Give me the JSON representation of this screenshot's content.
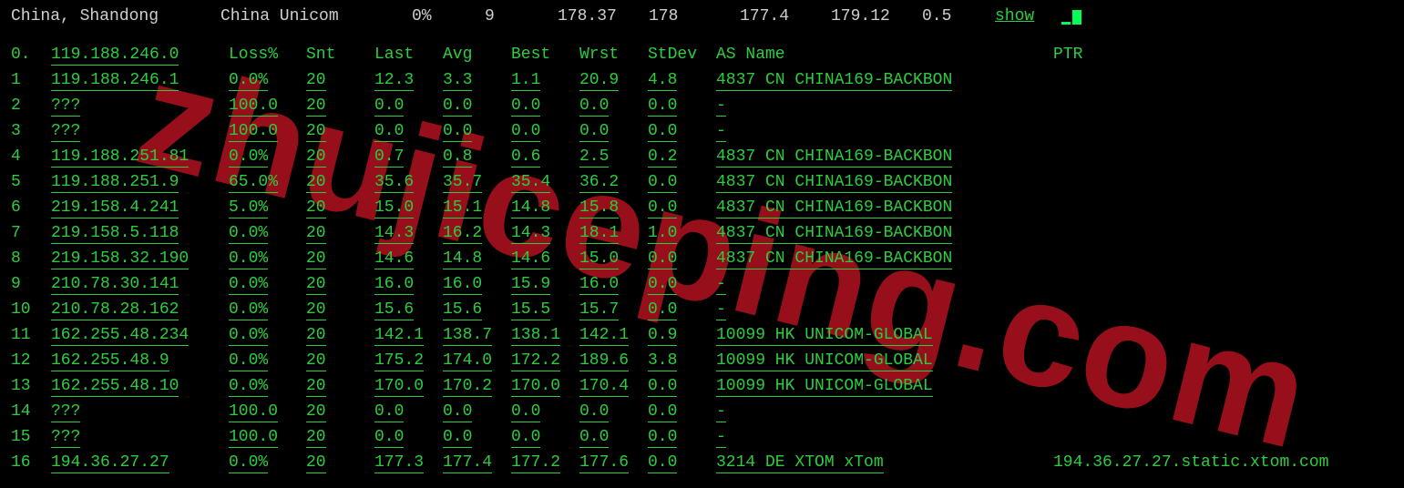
{
  "top": {
    "location": "China, Shandong",
    "isp": "China Unicom",
    "loss": "0%",
    "hops": "9",
    "avg": "178.37",
    "last": "178",
    "best": "177.4",
    "wrst": "179.12",
    "stdev": "0.5",
    "show": "show"
  },
  "headers": {
    "idx": "0.",
    "host": "119.188.246.0",
    "loss": "Loss%",
    "snt": "Snt",
    "last": "Last",
    "avg": "Avg",
    "best": "Best",
    "wrst": "Wrst",
    "stdev": "StDev",
    "asname": "AS Name",
    "ptr": "PTR"
  },
  "hops": [
    {
      "idx": "1",
      "host": "119.188.246.1",
      "loss": "0.0%",
      "snt": "20",
      "last": "12.3",
      "avg": "3.3",
      "best": "1.1",
      "wrst": "20.9",
      "stdev": "4.8",
      "as": "4837   CN CHINA169-BACKBON",
      "ptr": ""
    },
    {
      "idx": "2",
      "host": "???",
      "loss": "100.0",
      "snt": "20",
      "last": "0.0",
      "avg": "0.0",
      "best": "0.0",
      "wrst": "0.0",
      "stdev": "0.0",
      "as": "-",
      "ptr": ""
    },
    {
      "idx": "3",
      "host": "???",
      "loss": "100.0",
      "snt": "20",
      "last": "0.0",
      "avg": "0.0",
      "best": "0.0",
      "wrst": "0.0",
      "stdev": "0.0",
      "as": "-",
      "ptr": ""
    },
    {
      "idx": "4",
      "host": "119.188.251.81",
      "loss": "0.0%",
      "snt": "20",
      "last": "0.7",
      "avg": "0.8",
      "best": "0.6",
      "wrst": "2.5",
      "stdev": "0.2",
      "as": "4837   CN CHINA169-BACKBON",
      "ptr": ""
    },
    {
      "idx": "5",
      "host": "119.188.251.9",
      "loss": "65.0%",
      "snt": "20",
      "last": "35.6",
      "avg": "35.7",
      "best": "35.4",
      "wrst": "36.2",
      "stdev": "0.0",
      "as": "4837   CN CHINA169-BACKBON",
      "ptr": ""
    },
    {
      "idx": "6",
      "host": "219.158.4.241",
      "loss": "5.0%",
      "snt": "20",
      "last": "15.0",
      "avg": "15.1",
      "best": "14.8",
      "wrst": "15.8",
      "stdev": "0.0",
      "as": "4837   CN CHINA169-BACKBON",
      "ptr": ""
    },
    {
      "idx": "7",
      "host": "219.158.5.118",
      "loss": "0.0%",
      "snt": "20",
      "last": "14.3",
      "avg": "16.2",
      "best": "14.3",
      "wrst": "18.1",
      "stdev": "1.0",
      "as": "4837   CN CHINA169-BACKBON",
      "ptr": ""
    },
    {
      "idx": "8",
      "host": "219.158.32.190",
      "loss": "0.0%",
      "snt": "20",
      "last": "14.6",
      "avg": "14.8",
      "best": "14.6",
      "wrst": "15.0",
      "stdev": "0.0",
      "as": "4837   CN CHINA169-BACKBON",
      "ptr": ""
    },
    {
      "idx": "9",
      "host": "210.78.30.141",
      "loss": "0.0%",
      "snt": "20",
      "last": "16.0",
      "avg": "16.0",
      "best": "15.9",
      "wrst": "16.0",
      "stdev": "0.0",
      "as": "-",
      "ptr": ""
    },
    {
      "idx": "10",
      "host": "210.78.28.162",
      "loss": "0.0%",
      "snt": "20",
      "last": "15.6",
      "avg": "15.6",
      "best": "15.5",
      "wrst": "15.7",
      "stdev": "0.0",
      "as": "-",
      "ptr": ""
    },
    {
      "idx": "11",
      "host": "162.255.48.234",
      "loss": "0.0%",
      "snt": "20",
      "last": "142.1",
      "avg": "138.7",
      "best": "138.1",
      "wrst": "142.1",
      "stdev": "0.9",
      "as": "10099  HK UNICOM-GLOBAL",
      "ptr": ""
    },
    {
      "idx": "12",
      "host": "162.255.48.9",
      "loss": "0.0%",
      "snt": "20",
      "last": "175.2",
      "avg": "174.0",
      "best": "172.2",
      "wrst": "189.6",
      "stdev": "3.8",
      "as": "10099  HK UNICOM-GLOBAL",
      "ptr": ""
    },
    {
      "idx": "13",
      "host": "162.255.48.10",
      "loss": "0.0%",
      "snt": "20",
      "last": "170.0",
      "avg": "170.2",
      "best": "170.0",
      "wrst": "170.4",
      "stdev": "0.0",
      "as": "10099  HK UNICOM-GLOBAL",
      "ptr": ""
    },
    {
      "idx": "14",
      "host": "???",
      "loss": "100.0",
      "snt": "20",
      "last": "0.0",
      "avg": "0.0",
      "best": "0.0",
      "wrst": "0.0",
      "stdev": "0.0",
      "as": "-",
      "ptr": ""
    },
    {
      "idx": "15",
      "host": "???",
      "loss": "100.0",
      "snt": "20",
      "last": "0.0",
      "avg": "0.0",
      "best": "0.0",
      "wrst": "0.0",
      "stdev": "0.0",
      "as": "-",
      "ptr": ""
    },
    {
      "idx": "16",
      "host": "194.36.27.27",
      "loss": "0.0%",
      "snt": "20",
      "last": "177.3",
      "avg": "177.4",
      "best": "177.2",
      "wrst": "177.6",
      "stdev": "0.0",
      "as": "3214   DE XTOM xTom",
      "ptr": "194.36.27.27.static.xtom.com"
    }
  ],
  "watermark": "zhujiceping.com"
}
